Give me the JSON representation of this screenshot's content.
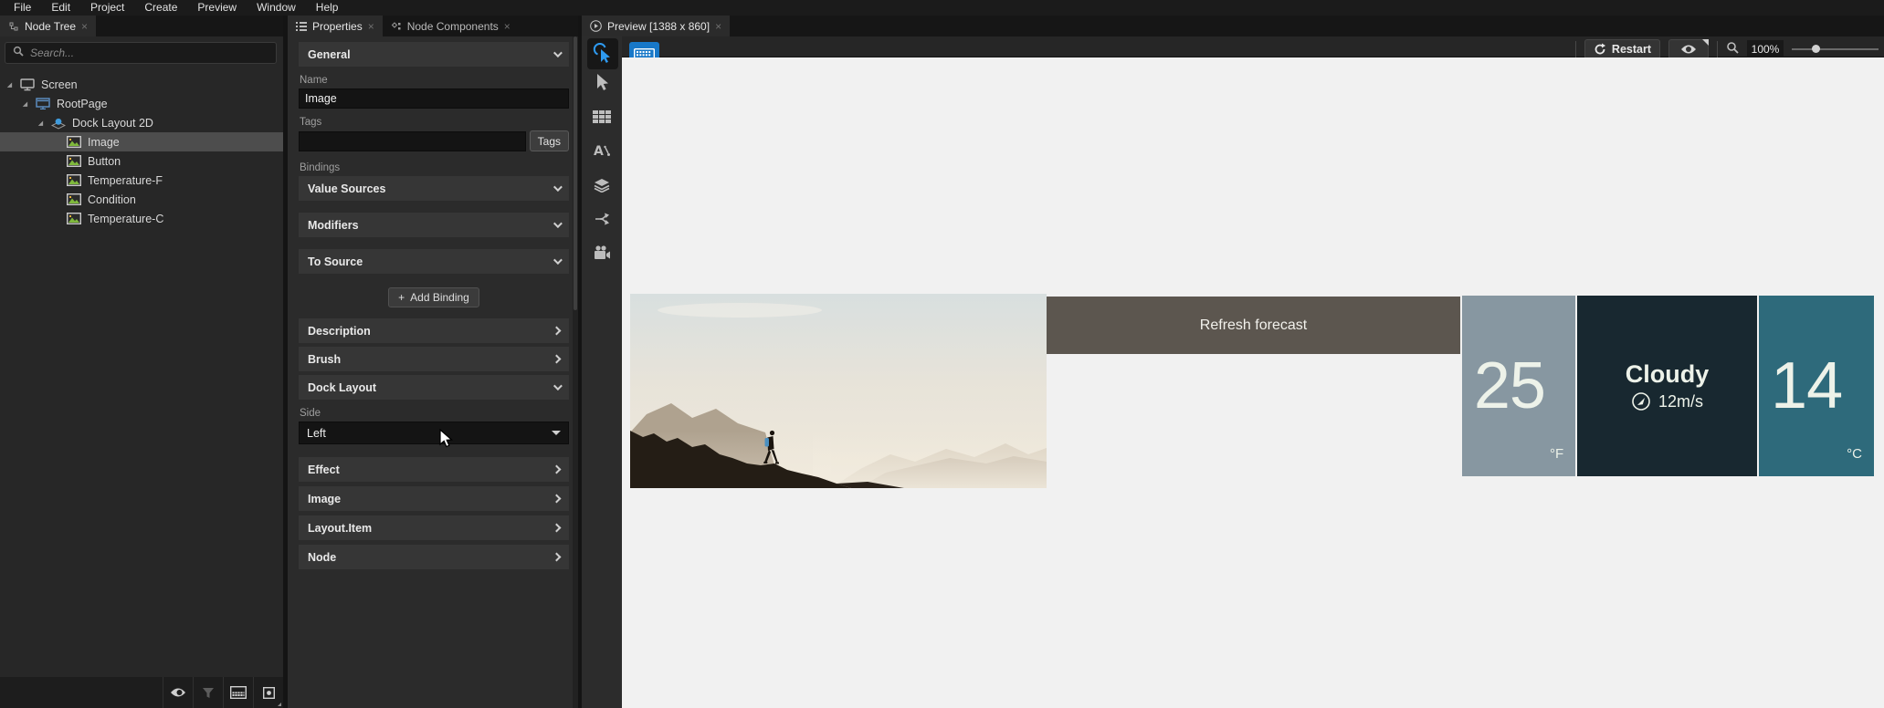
{
  "app": {
    "menu_items": [
      "File",
      "Edit",
      "Project",
      "Create",
      "Preview",
      "Window",
      "Help"
    ],
    "close_glyph": "×"
  },
  "node_tree": {
    "tab_label": "Node Tree",
    "search_placeholder": "Search...",
    "items": [
      {
        "label": "Screen"
      },
      {
        "label": "RootPage"
      },
      {
        "label": "Dock Layout 2D"
      },
      {
        "label": "Image",
        "selected": true
      },
      {
        "label": "Button"
      },
      {
        "label": "Temperature-F"
      },
      {
        "label": "Condition"
      },
      {
        "label": "Temperature-C"
      }
    ]
  },
  "properties_panel": {
    "tab_properties": "Properties",
    "tab_node_components": "Node Components",
    "general_header": "General",
    "name_label": "Name",
    "name_value": "Image",
    "tags_label": "Tags",
    "tags_value": "",
    "tags_button": "Tags",
    "bindings_label": "Bindings",
    "value_sources_header": "Value Sources",
    "modifiers_header": "Modifiers",
    "to_source_header": "To Source",
    "add_binding_plus": "+",
    "add_binding_label": "Add Binding",
    "description_header": "Description",
    "brush_header": "Brush",
    "dock_layout_header": "Dock Layout",
    "side_label": "Side",
    "side_value": "Left",
    "effect_header": "Effect",
    "image_header": "Image",
    "layout_item_header": "Layout.Item",
    "node_header": "Node"
  },
  "preview_panel": {
    "tab_label": "Preview [1388 x 860]",
    "restart_label": "Restart",
    "zoom_value": "100%",
    "app_ui": {
      "refresh_button": "Refresh forecast",
      "temp_f_value": "25",
      "temp_f_unit": "°F",
      "condition": "Cloudy",
      "wind_speed": "12m/s",
      "temp_c_value": "14",
      "temp_c_unit": "°C"
    },
    "colors": {
      "temp_f_bg": "#8797a1",
      "condition_bg": "#182830",
      "temp_c_bg": "#2e6a7b",
      "refresh_bg": "#5c564f",
      "panel_text": "#edf2e9",
      "accent_blue": "#2e9af0",
      "keyboard_button_bg": "#1878c8"
    }
  },
  "icons": {
    "tree_tab": "node-tree-icon",
    "search": "magnifier",
    "screen": "monitor",
    "rootpage": "page",
    "dock_layout": "layer-sphere",
    "node_image": "picture",
    "bottom_bar": [
      "eye",
      "filter-funnel",
      "checkered-grid",
      "square-dot"
    ],
    "preview_tools": [
      "interact-pointer",
      "virtual-keyboard",
      "select-arrow",
      "grid-table",
      "text-tool",
      "layers",
      "branch",
      "camera"
    ],
    "preview_controls": [
      "restart-arrow",
      "eye",
      "magnifier",
      "zoom-slider"
    ]
  }
}
